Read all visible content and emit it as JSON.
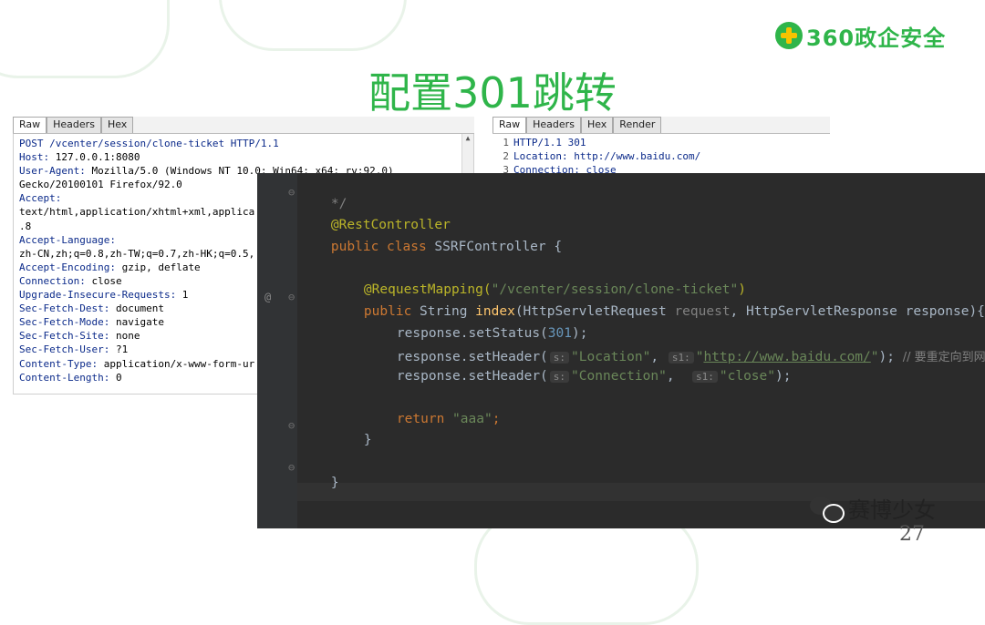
{
  "logo": {
    "text": "360政企安全"
  },
  "title": "配置301跳转",
  "request_panel": {
    "tabs": [
      "Raw",
      "Headers",
      "Hex"
    ],
    "lines": [
      {
        "k": "POST /vcenter/session/clone-ticket HTTP/1.1",
        "v": ""
      },
      {
        "k": "Host:",
        "v": " 127.0.0.1:8080"
      },
      {
        "k": "User-Agent:",
        "v": " Mozilla/5.0 (Windows NT 10.0; Win64; x64; rv:92.0)"
      },
      {
        "k": "",
        "v": "Gecko/20100101 Firefox/92.0"
      },
      {
        "k": "Accept:",
        "v": ""
      },
      {
        "k": "",
        "v": "text/html,application/xhtml+xml,applica"
      },
      {
        "k": "",
        "v": ".8"
      },
      {
        "k": "Accept-Language:",
        "v": ""
      },
      {
        "k": "",
        "v": "zh-CN,zh;q=0.8,zh-TW;q=0.7,zh-HK;q=0.5,"
      },
      {
        "k": "Accept-Encoding:",
        "v": " gzip, deflate"
      },
      {
        "k": "Connection:",
        "v": " close"
      },
      {
        "k": "Upgrade-Insecure-Requests:",
        "v": " 1"
      },
      {
        "k": "Sec-Fetch-Dest:",
        "v": " document"
      },
      {
        "k": "Sec-Fetch-Mode:",
        "v": " navigate"
      },
      {
        "k": "Sec-Fetch-Site:",
        "v": " none"
      },
      {
        "k": "Sec-Fetch-User:",
        "v": " ?1"
      },
      {
        "k": "Content-Type:",
        "v": " application/x-www-form-ur"
      },
      {
        "k": "Content-Length:",
        "v": " 0"
      }
    ]
  },
  "response_panel": {
    "tabs": [
      "Raw",
      "Headers",
      "Hex",
      "Render"
    ],
    "lines": [
      {
        "n": "1",
        "t": "HTTP/1.1 301"
      },
      {
        "n": "2",
        "t": "Location: http://www.baidu.com/"
      },
      {
        "n": "3",
        "t": "Connection: close"
      }
    ]
  },
  "code": {
    "comment_end": "*/",
    "annotation_class": "@RestController",
    "class_kw": "public class",
    "class_name": "SSRFController",
    "brace_open": "{",
    "mapping_ann": "@RequestMapping(",
    "mapping_path": "\"/vcenter/session/clone-ticket\"",
    "mapping_close": ")",
    "method_kw": "public",
    "method_type": "String",
    "method_name": "index",
    "method_params_1": "(HttpServletRequest ",
    "param_request": "request",
    "method_params_2": ", HttpServletResponse ",
    "param_response": "response",
    "method_params_3": "){",
    "set_status_pre": "response.setStatus(",
    "status_code": "301",
    "set_status_post": ");",
    "set_header_pre": "response.setHeader(",
    "hint_s": "s:",
    "hint_s1": "s1:",
    "location_str": "\"Location\"",
    "comma": ",",
    "url_quote_open": "\"",
    "url": "http://www.baidu.com/",
    "url_quote_close": "\"",
    "stmt_end": ");",
    "redirect_comment": "// 要重定向到网",
    "connection_str": "\"Connection\"",
    "close_str": "\"close\"",
    "return_kw": "return",
    "return_val": "\"aaa\"",
    "semicolon": ";",
    "brace_close": "}",
    "brace_close_class": "}",
    "gutter_at": "@"
  },
  "footer": {
    "wechat_name": "赛博少女",
    "page_number": "27"
  }
}
